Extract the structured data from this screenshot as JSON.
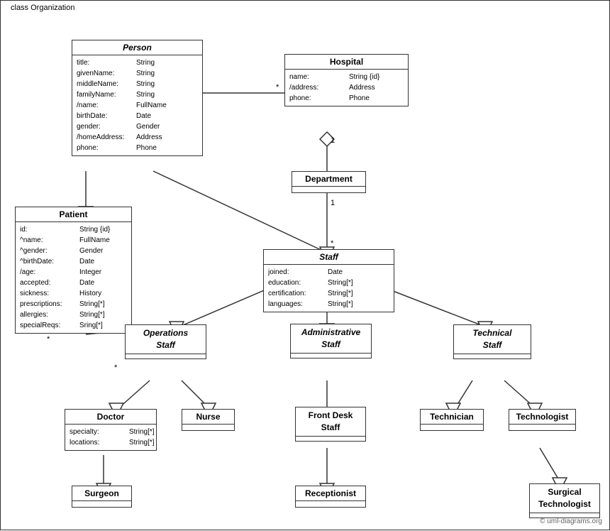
{
  "diagram": {
    "title": "class Organization",
    "classes": {
      "person": {
        "name": "Person",
        "italic": true,
        "attributes": [
          {
            "name": "title:",
            "type": "String"
          },
          {
            "name": "givenName:",
            "type": "String"
          },
          {
            "name": "middleName:",
            "type": "String"
          },
          {
            "name": "familyName:",
            "type": "String"
          },
          {
            "name": "/name:",
            "type": "FullName"
          },
          {
            "name": "birthDate:",
            "type": "Date"
          },
          {
            "name": "gender:",
            "type": "Gender"
          },
          {
            "name": "/homeAddress:",
            "type": "Address"
          },
          {
            "name": "phone:",
            "type": "Phone"
          }
        ]
      },
      "hospital": {
        "name": "Hospital",
        "italic": false,
        "attributes": [
          {
            "name": "name:",
            "type": "String {id}"
          },
          {
            "name": "/address:",
            "type": "Address"
          },
          {
            "name": "phone:",
            "type": "Phone"
          }
        ]
      },
      "department": {
        "name": "Department",
        "italic": false,
        "attributes": []
      },
      "staff": {
        "name": "Staff",
        "italic": true,
        "attributes": [
          {
            "name": "joined:",
            "type": "Date"
          },
          {
            "name": "education:",
            "type": "String[*]"
          },
          {
            "name": "certification:",
            "type": "String[*]"
          },
          {
            "name": "languages:",
            "type": "String[*]"
          }
        ]
      },
      "patient": {
        "name": "Patient",
        "italic": false,
        "attributes": [
          {
            "name": "id:",
            "type": "String {id}"
          },
          {
            "name": "^name:",
            "type": "FullName"
          },
          {
            "name": "^gender:",
            "type": "Gender"
          },
          {
            "name": "^birthDate:",
            "type": "Date"
          },
          {
            "name": "/age:",
            "type": "Integer"
          },
          {
            "name": "accepted:",
            "type": "Date"
          },
          {
            "name": "sickness:",
            "type": "History"
          },
          {
            "name": "prescriptions:",
            "type": "String[*]"
          },
          {
            "name": "allergies:",
            "type": "String[*]"
          },
          {
            "name": "specialReqs:",
            "type": "Sring[*]"
          }
        ]
      },
      "operations_staff": {
        "name": "Operations\nStaff",
        "italic": true,
        "attributes": []
      },
      "administrative_staff": {
        "name": "Administrative\nStaff",
        "italic": true,
        "attributes": []
      },
      "technical_staff": {
        "name": "Technical\nStaff",
        "italic": true,
        "attributes": []
      },
      "doctor": {
        "name": "Doctor",
        "italic": false,
        "attributes": [
          {
            "name": "specialty:",
            "type": "String[*]"
          },
          {
            "name": "locations:",
            "type": "String[*]"
          }
        ]
      },
      "nurse": {
        "name": "Nurse",
        "italic": false,
        "attributes": []
      },
      "front_desk_staff": {
        "name": "Front Desk\nStaff",
        "italic": false,
        "attributes": []
      },
      "technician": {
        "name": "Technician",
        "italic": false,
        "attributes": []
      },
      "technologist": {
        "name": "Technologist",
        "italic": false,
        "attributes": []
      },
      "surgeon": {
        "name": "Surgeon",
        "italic": false,
        "attributes": []
      },
      "receptionist": {
        "name": "Receptionist",
        "italic": false,
        "attributes": []
      },
      "surgical_technologist": {
        "name": "Surgical\nTechnologist",
        "italic": false,
        "attributes": []
      }
    },
    "copyright": "© uml-diagrams.org"
  }
}
